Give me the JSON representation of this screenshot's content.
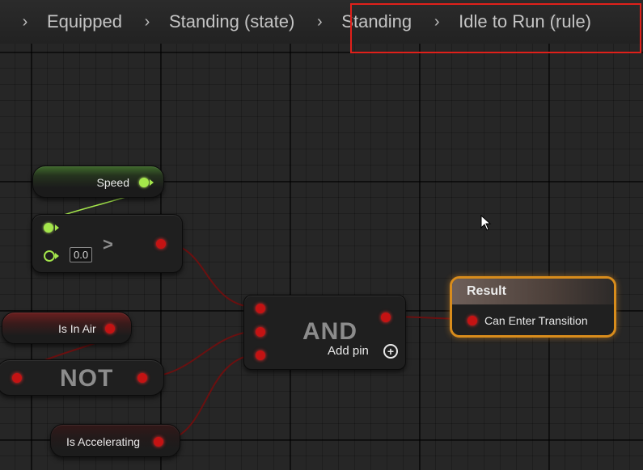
{
  "breadcrumb": {
    "items": [
      "Equipped",
      "Standing (state)",
      "Standing",
      "Idle to Run (rule)"
    ],
    "ghost": "1"
  },
  "nodes": {
    "speed": {
      "label": "Speed"
    },
    "greater": {
      "operator": ">",
      "value": "0.0"
    },
    "is_in_air": {
      "label": "Is In Air"
    },
    "not": {
      "label": "NOT"
    },
    "and": {
      "label": "AND",
      "add_pin": "Add pin"
    },
    "is_accelerating": {
      "label": "Is Accelerating"
    },
    "result": {
      "title": "Result",
      "pin_label": "Can Enter Transition"
    }
  },
  "colors": {
    "bool_pin": "#c41313",
    "float_pin": "#a4e64b",
    "highlight_border": "#e0201a",
    "result_border": "#d88c1c"
  },
  "icons": {
    "add_pin": "plus-circle-icon",
    "cursor": "mouse-cursor-icon",
    "separator": "chevron-right-icon"
  }
}
